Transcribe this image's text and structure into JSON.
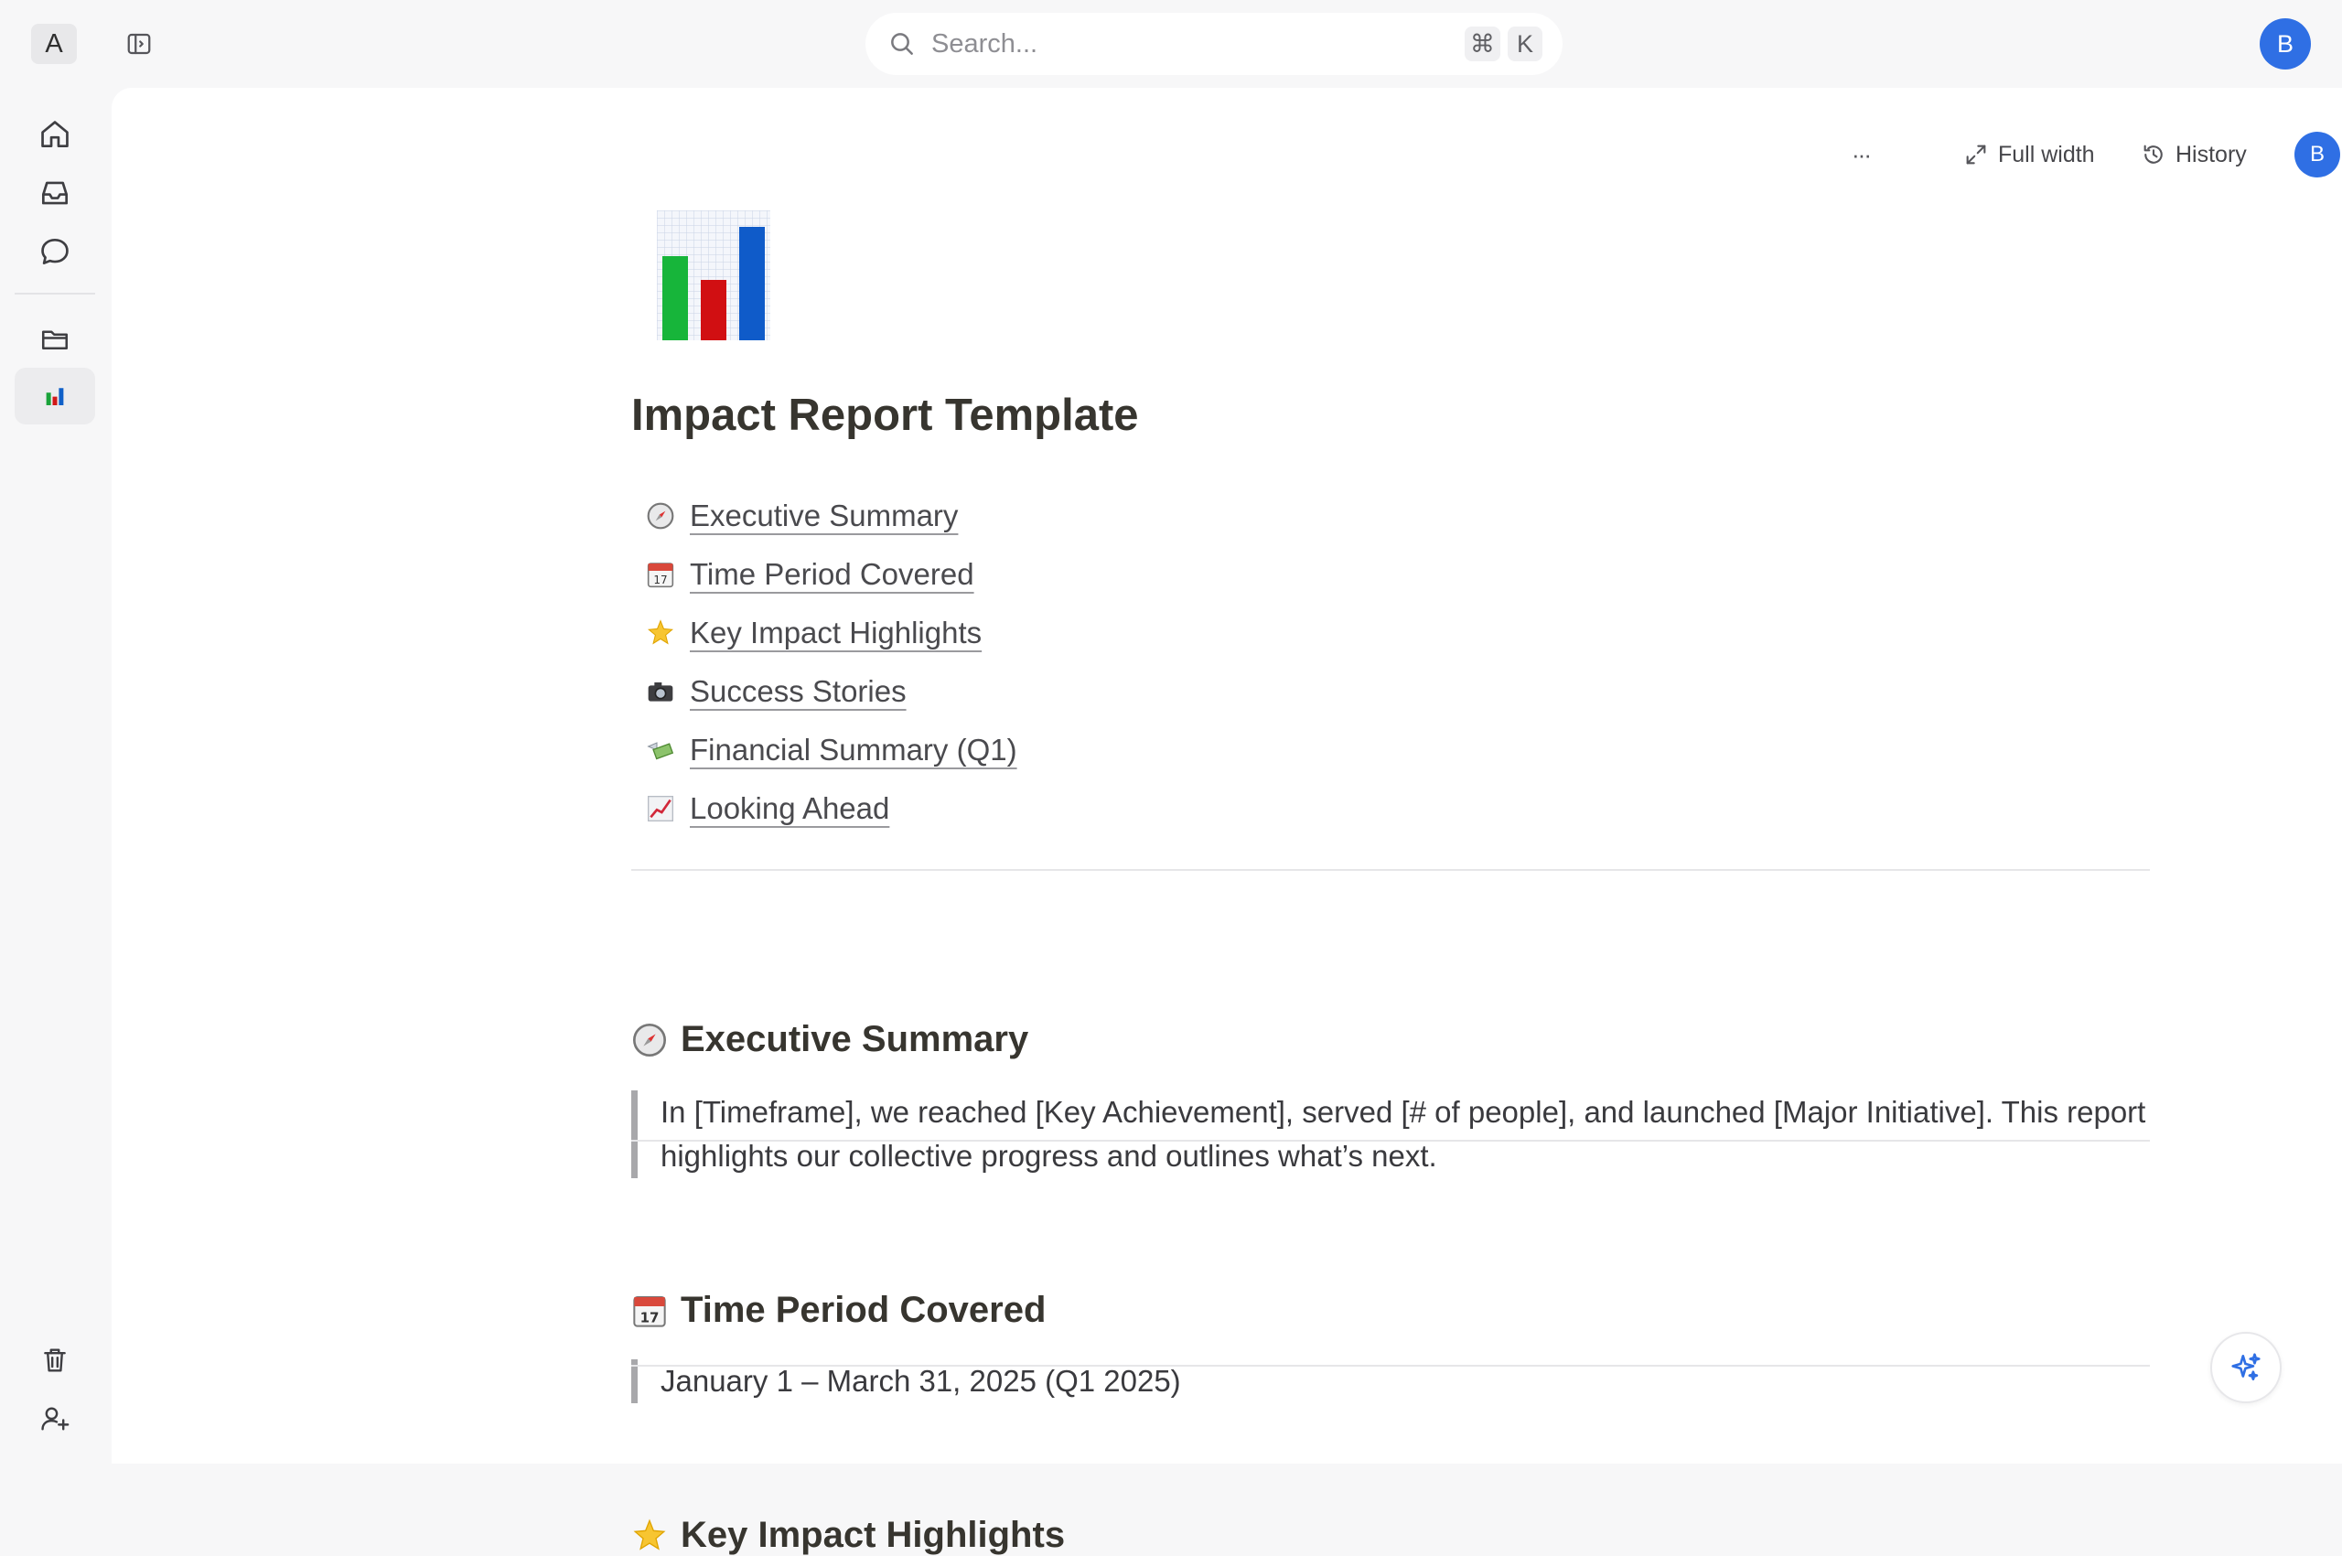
{
  "topbar": {
    "workspace_letter": "A",
    "search_placeholder": "Search...",
    "shortcut_keys": [
      "⌘",
      "K"
    ],
    "user_initial": "B"
  },
  "rail": {
    "items": [
      {
        "name": "home",
        "icon": "home-icon"
      },
      {
        "name": "inbox",
        "icon": "inbox-icon"
      },
      {
        "name": "chat",
        "icon": "chat-icon"
      },
      {
        "name": "files",
        "icon": "folder-icon"
      },
      {
        "name": "impact-report",
        "icon": "bar-chart-icon",
        "active": true
      }
    ],
    "bottom": [
      {
        "name": "trash",
        "icon": "trash-icon"
      },
      {
        "name": "invite",
        "icon": "add-user-icon"
      }
    ]
  },
  "toolbar": {
    "more_label": "···",
    "full_width_label": "Full width",
    "history_label": "History",
    "user_initial": "B"
  },
  "doc": {
    "icon": "bar-chart-emoji",
    "title": "Impact Report Template",
    "toc": [
      {
        "emoji": "compass",
        "label": "Executive Summary"
      },
      {
        "emoji": "calendar",
        "label": "Time Period Covered"
      },
      {
        "emoji": "glowing-star",
        "label": "Key Impact Highlights"
      },
      {
        "emoji": "camera",
        "label": "Success Stories"
      },
      {
        "emoji": "money-with-wings",
        "label": "Financial Summary (Q1)"
      },
      {
        "emoji": "chart-increasing",
        "label": "Looking Ahead"
      }
    ],
    "sections": [
      {
        "emoji": "compass",
        "heading": "Executive Summary",
        "quote": "In [Timeframe], we reached [Key Achievement], served [# of people], and launched [Major Initiative]. This report highlights our collective progress and outlines what’s next."
      },
      {
        "emoji": "calendar",
        "heading": "Time Period Covered",
        "quote": "January 1 – March 31, 2025 (Q1 2025)"
      },
      {
        "emoji": "glowing-star",
        "heading": "Key Impact Highlights"
      }
    ]
  },
  "colors": {
    "accent": "#2f6fe4",
    "background": "#f7f7f8",
    "surface": "#ffffff"
  }
}
